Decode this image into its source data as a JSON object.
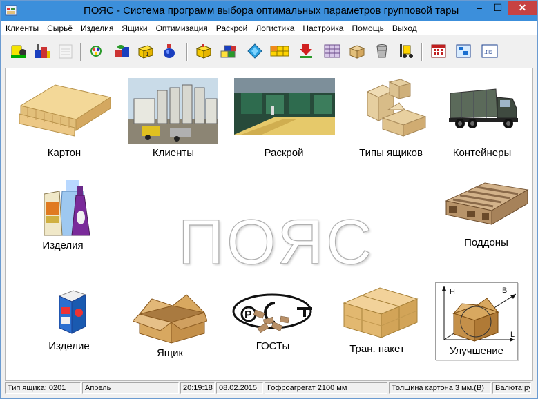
{
  "window": {
    "title": "ПОЯС - Система программ выбора оптимальных параметров групповой тары",
    "minimize_glyph": "–",
    "maximize_glyph": "☐",
    "close_glyph": "✕"
  },
  "menu": [
    {
      "label": "Клиенты"
    },
    {
      "label": "Сырьё"
    },
    {
      "label": "Изделия"
    },
    {
      "label": "Ящики"
    },
    {
      "label": "Оптимизация"
    },
    {
      "label": "Раскрой"
    },
    {
      "label": "Логистика"
    },
    {
      "label": "Настройка"
    },
    {
      "label": "Помощь"
    },
    {
      "label": "Выход"
    }
  ],
  "toolbar": [
    {
      "icon": "clients-icon"
    },
    {
      "icon": "factory-icon"
    },
    {
      "icon": "disabled-doc-icon"
    },
    {
      "icon": "palette-icon"
    },
    {
      "icon": "boxes-cylinders-icon"
    },
    {
      "icon": "box-open-icon"
    },
    {
      "icon": "bottle-icon"
    },
    {
      "icon": "box-layout-icon"
    },
    {
      "icon": "color-boxes-icon"
    },
    {
      "icon": "diamond-icon"
    },
    {
      "icon": "grid-icon"
    },
    {
      "icon": "download-arrow-icon"
    },
    {
      "icon": "stack-boxes-icon"
    },
    {
      "icon": "carton-icon"
    },
    {
      "icon": "bucket-icon"
    },
    {
      "icon": "forklift-icon"
    },
    {
      "icon": "calendar-table-icon"
    },
    {
      "icon": "screen-icon"
    },
    {
      "icon": "utils-icon"
    }
  ],
  "tiles": {
    "karton": "Картон",
    "clients": "Клиенты",
    "raskroy": "Раскрой",
    "box_types": "Типы ящиков",
    "containers": "Контейнеры",
    "products": "Изделия",
    "pallets": "Поддоны",
    "product": "Изделие",
    "box": "Ящик",
    "gosts": "ГОСТы",
    "tran_packet": "Тран. пакет",
    "improvement": "Улучшение"
  },
  "watermark": "ПОЯС",
  "improve_diagram": {
    "h": "H",
    "b": "B",
    "l": "L"
  },
  "gost_logo": {
    "letters": "Р С Т"
  },
  "status": {
    "box_type": "Тип ящика: 0201",
    "month": "Апрель",
    "time": "20:19:18",
    "date": "08.02.2015",
    "corrugator": "Гофроагрегат 2100 мм",
    "thickness": "Толщина картона 3 мм.(В)",
    "currency": "Валюта:ру"
  },
  "colors": {
    "titlebar": "#3c8fdb",
    "close": "#c74242",
    "cardboard": "#e2bf7a"
  }
}
